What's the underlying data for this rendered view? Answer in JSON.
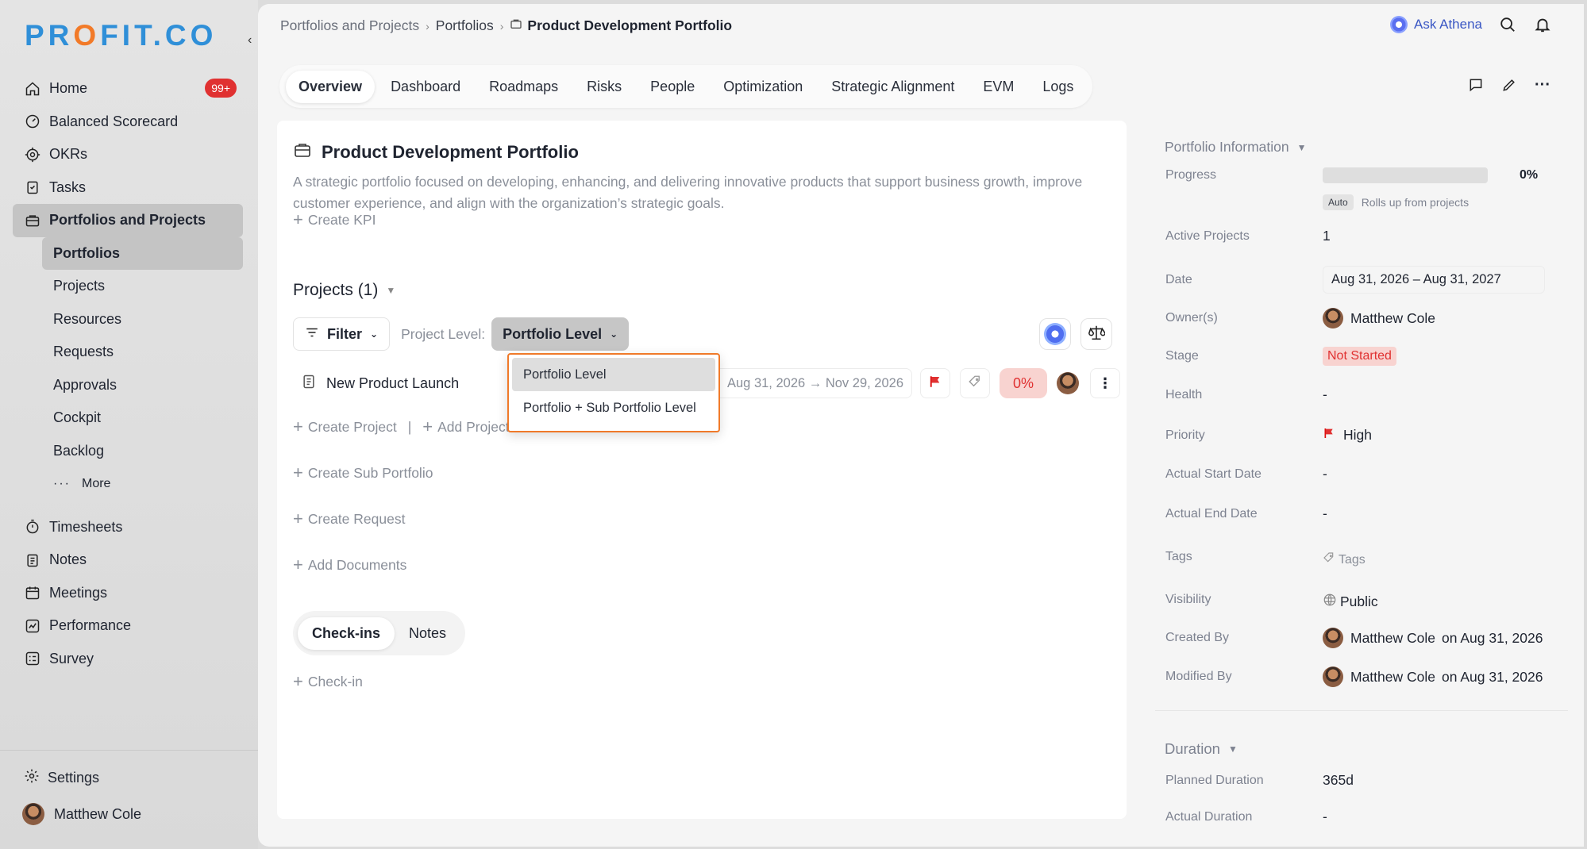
{
  "brand": {
    "logo_pre": "PR",
    "logo_o": "O",
    "logo_post": "FIT.CO"
  },
  "sidebar": {
    "collapse_icon": "‹",
    "items": [
      {
        "label": "Home",
        "badge": "99+"
      },
      {
        "label": "Balanced Scorecard"
      },
      {
        "label": "OKRs"
      },
      {
        "label": "Tasks"
      },
      {
        "label": "Portfolios and Projects"
      }
    ],
    "subitems": [
      "Portfolios",
      "Projects",
      "Resources",
      "Requests",
      "Approvals",
      "Cockpit",
      "Backlog",
      "More"
    ],
    "items2": [
      "Timesheets",
      "Notes",
      "Meetings",
      "Performance",
      "Survey"
    ],
    "settings": "Settings",
    "user": "Matthew Cole"
  },
  "breadcrumb": {
    "root": "Portfolios and Projects",
    "mid": "Portfolios",
    "current": "Product Development Portfolio"
  },
  "header": {
    "ask": "Ask Athena"
  },
  "tabs": [
    "Overview",
    "Dashboard",
    "Roadmaps",
    "Risks",
    "People",
    "Optimization",
    "Strategic Alignment",
    "EVM",
    "Logs"
  ],
  "portfolio": {
    "title": "Product Development Portfolio",
    "description": "A strategic portfolio focused on developing, enhancing, and delivering innovative products that support business growth, improve customer experience, and align with the organization’s strategic goals.",
    "create_kpi": "Create KPI",
    "projects_heading": "Projects (1)",
    "filter": "Filter",
    "project_level_label": "Project Level:",
    "project_level_value": "Portfolio Level",
    "dropdown": [
      "Portfolio Level",
      "Portfolio + Sub Portfolio Level"
    ],
    "project": {
      "name": "New Product Launch",
      "dates": "Aug 31, 2026 → Nov 29, 2026",
      "progress": "0%"
    },
    "create_project": "Create Project",
    "divider": "|",
    "add_project": "Add Projects",
    "create_sub": "Create Sub Portfolio",
    "create_request": "Create Request",
    "add_docs": "Add Documents",
    "checkin_tabs": [
      "Check-ins",
      "Notes"
    ],
    "checkin": "Check-in"
  },
  "info": {
    "heading": "Portfolio Information",
    "progress_label": "Progress",
    "progress_value": "0%",
    "progress_fraction": 0,
    "auto_chip": "Auto",
    "auto_text": "Rolls up from projects",
    "active_label": "Active Projects",
    "active_value": "1",
    "date_label": "Date",
    "date_value": "Aug 31, 2026 – Aug 31, 2027",
    "owner_label": "Owner(s)",
    "owner_value": "Matthew Cole",
    "stage_label": "Stage",
    "stage_value": "Not Started",
    "health_label": "Health",
    "health_value": "-",
    "priority_label": "Priority",
    "priority_value": "High",
    "start_label": "Actual Start Date",
    "start_value": "-",
    "end_label": "Actual End Date",
    "end_value": "-",
    "tags_label": "Tags",
    "tags_value": "Tags",
    "visibility_label": "Visibility",
    "visibility_value": "Public",
    "created_label": "Created By",
    "created_by": "Matthew Cole",
    "created_on": "on Aug 31, 2026",
    "modified_label": "Modified By",
    "modified_by": "Matthew Cole",
    "modified_on": "on Aug 31, 2026",
    "duration_heading": "Duration",
    "planned_label": "Planned Duration",
    "planned_value": "365d",
    "actual_dur_label": "Actual Duration",
    "actual_dur_value": "-"
  },
  "colors": {
    "accent_blue": "#2f8fd8",
    "accent_orange": "#f27a28",
    "danger": "#e03131",
    "dropdown_border": "#f07a2a"
  }
}
